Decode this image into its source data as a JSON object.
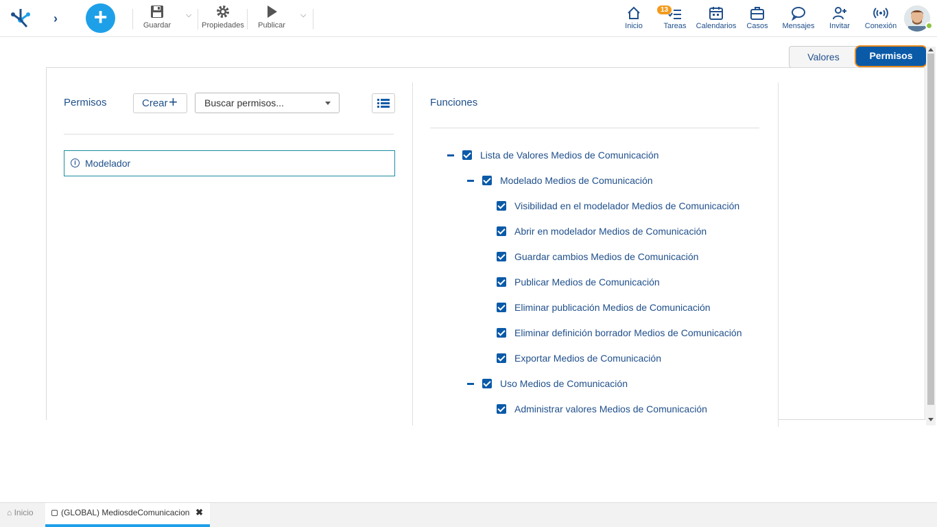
{
  "toolbar": {
    "guardar": "Guardar",
    "propiedades": "Propiedades",
    "publicar": "Publicar"
  },
  "nav": {
    "inicio": "Inicio",
    "tareas": "Tareas",
    "tareas_badge": "13",
    "calendarios": "Calendarios",
    "casos": "Casos",
    "mensajes": "Mensajes",
    "invitar": "Invitar",
    "conexion": "Conexión"
  },
  "view_toggle": {
    "valores": "Valores",
    "permisos": "Permisos"
  },
  "left": {
    "title": "Permisos",
    "crear": "Crear",
    "search_value": "Buscar permisos...",
    "item": "Modelador"
  },
  "right": {
    "title": "Funciones",
    "tree": [
      {
        "label": "Lista de Valores Medios de Comunicación",
        "level": 0,
        "checked": true,
        "expanded": true
      },
      {
        "label": "Modelado Medios de Comunicación",
        "level": 1,
        "checked": true,
        "expanded": true
      },
      {
        "label": "Visibilidad en el modelador Medios de Comunicación",
        "level": 2,
        "checked": true
      },
      {
        "label": "Abrir en modelador Medios de Comunicación",
        "level": 2,
        "checked": true
      },
      {
        "label": "Guardar cambios Medios de Comunicación",
        "level": 2,
        "checked": true
      },
      {
        "label": "Publicar Medios de Comunicación",
        "level": 2,
        "checked": true
      },
      {
        "label": "Eliminar publicación Medios de Comunicación",
        "level": 2,
        "checked": true
      },
      {
        "label": "Eliminar definición borrador Medios de Comunicación",
        "level": 2,
        "checked": true
      },
      {
        "label": "Exportar Medios de Comunicación",
        "level": 2,
        "checked": true
      },
      {
        "label": "Uso Medios de Comunicación",
        "level": 1,
        "checked": true,
        "expanded": true
      },
      {
        "label": "Administrar valores Medios de Comunicación",
        "level": 2,
        "checked": true
      }
    ]
  },
  "bottom_tabs": {
    "inicio": "Inicio",
    "active": "(GLOBAL) MediosdeComunicacion"
  }
}
